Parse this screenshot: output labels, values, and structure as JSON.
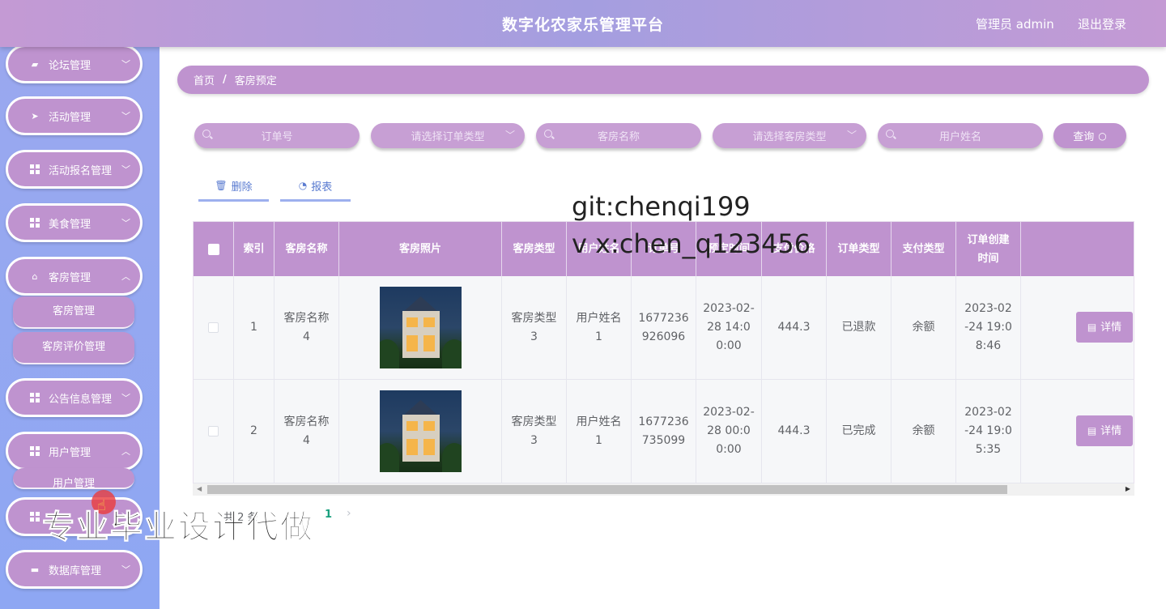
{
  "header": {
    "title": "数字化农家乐管理平台",
    "user": "管理员 admin",
    "logout": "退出登录"
  },
  "sidebar": {
    "menus": [
      {
        "label": "论坛管理"
      },
      {
        "label": "活动管理"
      },
      {
        "label": "活动报名管理"
      },
      {
        "label": "美食管理"
      },
      {
        "label": "客房管理"
      },
      {
        "label": "公告信息管理"
      },
      {
        "label": "用户管理"
      },
      {
        "label": "数据库管理"
      }
    ],
    "sub_room": [
      "客房管理",
      "客房评价管理"
    ],
    "sub_user": [
      "用户管理"
    ]
  },
  "breadcrumb": {
    "home": "首页",
    "sep": "/",
    "current": "客房预定"
  },
  "search": {
    "order_no": "订单号",
    "order_type": "请选择订单类型",
    "room_name": "客房名称",
    "room_type": "请选择客房类型",
    "user_name": "用户姓名",
    "query": "查询"
  },
  "toolbar": {
    "delete": "删除",
    "report": "报表"
  },
  "table": {
    "headers": [
      "索引",
      "客房名称",
      "客房照片",
      "客房类型",
      "用户姓名",
      "订单号",
      "预定时间",
      "支付价格",
      "订单类型",
      "支付类型",
      "订单创建时间"
    ],
    "rows": [
      {
        "index": "1",
        "room_name": "客房名称4",
        "room_type": "客房类型3",
        "user_name": "用户姓名1",
        "order_no": "1677236926096",
        "reserve_time": "2023-02-28 14:00:00",
        "price": "444.3",
        "order_type": "已退款",
        "pay_type": "余额",
        "created": "2023-02-24 19:08:46",
        "action": "详情"
      },
      {
        "index": "2",
        "room_name": "客房名称4",
        "room_type": "客房类型3",
        "user_name": "用户姓名1",
        "order_no": "1677236735099",
        "reserve_time": "2023-02-28 00:00:00",
        "price": "444.3",
        "order_type": "已完成",
        "pay_type": "余额",
        "created": "2023-02-24 19:05:35",
        "action": "详情"
      }
    ]
  },
  "pagination": {
    "total": "共 2 条",
    "page": "1"
  },
  "watermarks": {
    "git": "git:chenqi199",
    "vx": "v x:chen_q123456",
    "promo": "专业毕业设计代做"
  },
  "colors": {
    "accent": "#bf93cf",
    "sidebar": "#9aa8ef",
    "header": "#a49ee0"
  }
}
